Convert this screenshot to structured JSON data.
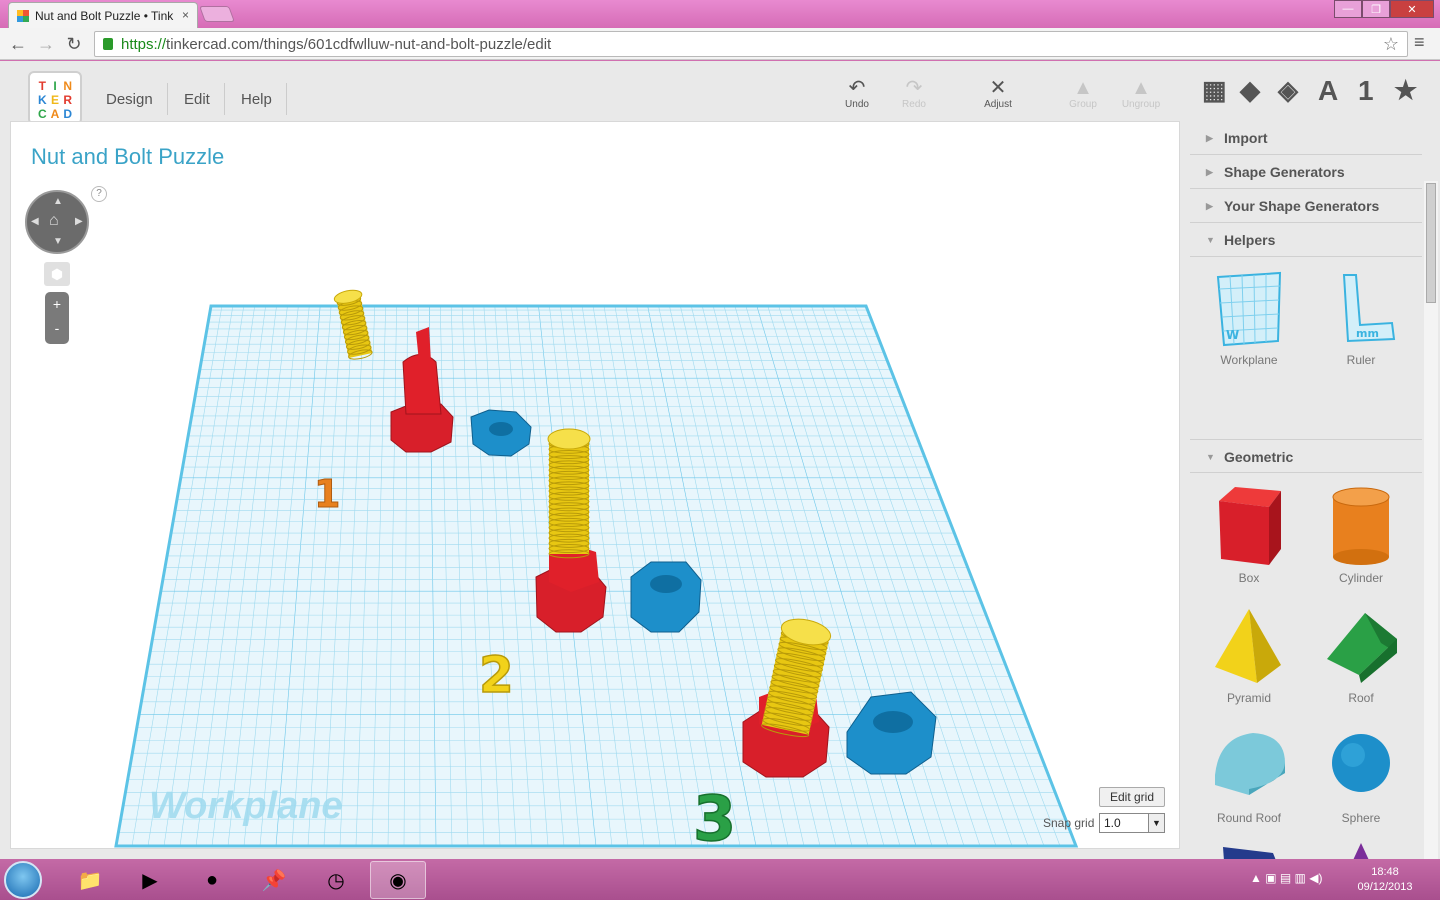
{
  "browser": {
    "tab_title": "Nut and Bolt Puzzle • Tink",
    "tab_close": "×",
    "url_https": "https://",
    "url_rest": "tinkercad.com/things/601cdfwlluw-nut-and-bolt-puzzle/edit",
    "back_icon": "←",
    "forward_icon": "→",
    "reload_icon": "↻",
    "bookmark_icon": "☆",
    "menu_icon": "≡",
    "win_min": "—",
    "win_max": "❐",
    "win_close": "✕"
  },
  "app": {
    "logo": [
      "T",
      "I",
      "N",
      "K",
      "E",
      "R",
      "C",
      "A",
      "D"
    ],
    "menu": [
      "Design",
      "Edit",
      "Help"
    ],
    "tools": [
      {
        "label": "Undo",
        "icon": "↶",
        "enabled": true
      },
      {
        "label": "Redo",
        "icon": "↷",
        "enabled": false
      },
      {
        "label": "Adjust",
        "icon": "✕",
        "enabled": true
      },
      {
        "label": "Group",
        "icon": "▲",
        "enabled": false
      },
      {
        "label": "Ungroup",
        "icon": "▲",
        "enabled": false
      }
    ],
    "view_icons": [
      "grid-view-icon",
      "box-view-icon",
      "wireframe-view-icon",
      "text-icon",
      "number-icon",
      "favorites-icon"
    ],
    "view_glyphs": [
      "▦",
      "◆",
      "◈",
      "A",
      "1",
      "★"
    ]
  },
  "canvas": {
    "title": "Nut and Bolt Puzzle",
    "help": "?",
    "zoom_in": "+",
    "zoom_out": "-",
    "workplane_label": "Workplane",
    "edit_grid": "Edit grid",
    "snap_label": "Snap grid",
    "snap_value": "1.0",
    "numbers": [
      "1",
      "2",
      "3"
    ],
    "colors": {
      "grid": "#5cc3e6",
      "red": "#e0202a",
      "yellow": "#f2d21a",
      "blue": "#1d8fca",
      "orange": "#e8801e",
      "green": "#2aa046"
    }
  },
  "sidebar": {
    "sections": [
      "Import",
      "Shape Generators",
      "Your Shape Generators",
      "Helpers",
      "Geometric"
    ],
    "helpers": [
      "Workplane",
      "Ruler"
    ],
    "geometric": [
      "Box",
      "Cylinder",
      "Pyramid",
      "Roof",
      "Round Roof",
      "Sphere"
    ]
  },
  "taskbar": {
    "time": "18:48",
    "date": "09/12/2013"
  }
}
